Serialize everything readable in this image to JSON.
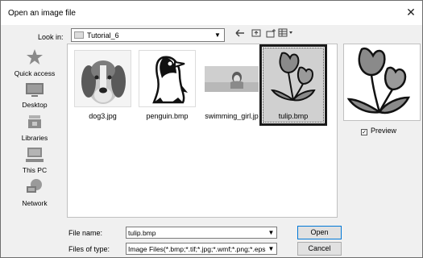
{
  "window": {
    "title": "Open an image file",
    "close_glyph": "✕"
  },
  "lookin": {
    "label": "Look in:",
    "value": "Tutorial_6"
  },
  "toolbar": {
    "back_icon": "back-arrow-icon",
    "up_icon": "up-folder-icon",
    "newfolder_icon": "new-folder-icon",
    "view_icon": "view-menu-icon"
  },
  "places": [
    {
      "label": "Quick access",
      "icon": "star-icon"
    },
    {
      "label": "Desktop",
      "icon": "desktop-icon"
    },
    {
      "label": "Libraries",
      "icon": "libraries-icon"
    },
    {
      "label": "This PC",
      "icon": "pc-icon"
    },
    {
      "label": "Network",
      "icon": "network-icon"
    }
  ],
  "files": [
    {
      "name": "dog3.jpg"
    },
    {
      "name": "penguin.bmp"
    },
    {
      "name": "swimming_girl.jp"
    },
    {
      "name": "tulip.bmp",
      "selected": true
    }
  ],
  "preview": {
    "label": "Preview",
    "checked": true,
    "check_glyph": "✓"
  },
  "filename": {
    "label": "File name:",
    "value": "tulip.bmp"
  },
  "filetype": {
    "label": "Files of type:",
    "value": "Image Files(*.bmp;*.tif;*.jpg;*.wmf;*.png;*.eps;*.g"
  },
  "buttons": {
    "open": "Open",
    "cancel": "Cancel"
  }
}
